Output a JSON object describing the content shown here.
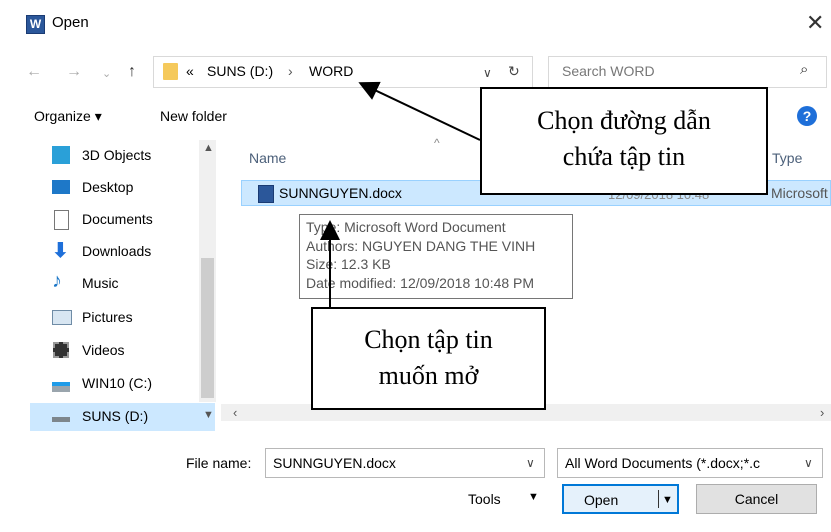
{
  "window": {
    "title": "Open",
    "app_icon": "W"
  },
  "nav": {
    "address": {
      "prefix": "«",
      "segments": [
        "SUNS (D:)",
        "WORD"
      ]
    },
    "search_placeholder": "Search WORD"
  },
  "toolbar": {
    "organize": "Organize ▾",
    "new_folder": "New folder"
  },
  "sidebar": {
    "items": [
      {
        "label": "3D Objects",
        "icon": "cube-icon"
      },
      {
        "label": "Desktop",
        "icon": "desktop-icon"
      },
      {
        "label": "Documents",
        "icon": "documents-icon"
      },
      {
        "label": "Downloads",
        "icon": "download-icon"
      },
      {
        "label": "Music",
        "icon": "music-icon"
      },
      {
        "label": "Pictures",
        "icon": "pictures-icon"
      },
      {
        "label": "Videos",
        "icon": "videos-icon"
      },
      {
        "label": "WIN10 (C:)",
        "icon": "drive-icon"
      },
      {
        "label": "SUNS (D:)",
        "icon": "drive-icon",
        "selected": true
      }
    ]
  },
  "list": {
    "columns": {
      "name": "Name",
      "type": "Type"
    },
    "file": {
      "name": "SUNNGUYEN.docx",
      "date": "12/09/2018 10:48",
      "type": "Microsoft"
    }
  },
  "tooltip": {
    "type": "Type: Microsoft Word Document",
    "authors": "Authors: NGUYEN DANG THE VINH",
    "size": "Size: 12.3 KB",
    "modified": "Date modified: 12/09/2018 10:48 PM"
  },
  "annotations": {
    "path_line1": "Chọn đường dẫn",
    "path_line2": "chứa tập tin",
    "file_line1": "Chọn tập tin",
    "file_line2": "muốn mở"
  },
  "footer": {
    "filename_label": "File name:",
    "filename_value": "SUNNGUYEN.docx",
    "filter_value": "All Word Documents (*.docx;*.c",
    "tools": "Tools",
    "open": "Open",
    "cancel": "Cancel"
  },
  "colors": {
    "selection": "#cce8ff",
    "accent": "#1e6fd9",
    "word_blue": "#2b579a"
  }
}
